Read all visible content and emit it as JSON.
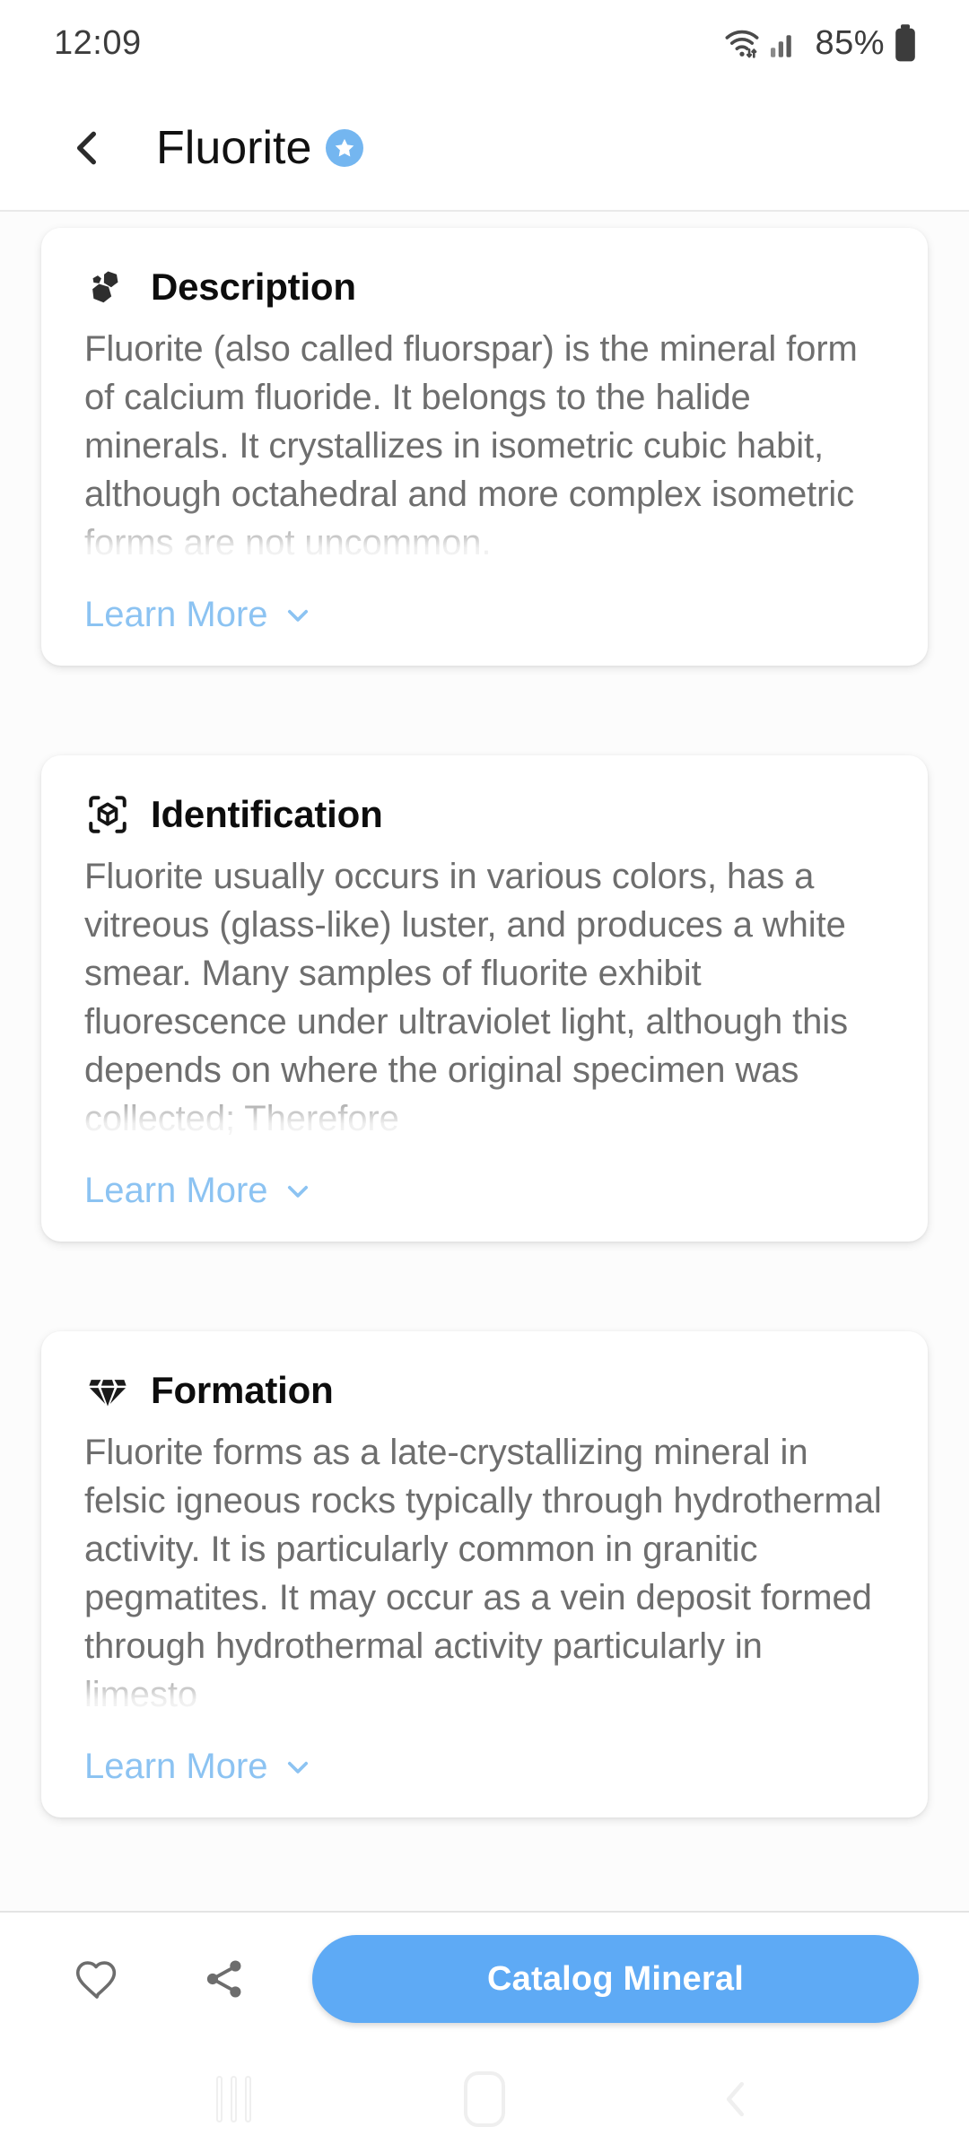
{
  "status_bar": {
    "time": "12:09",
    "battery_percent": "85%",
    "wifi_icon": "wifi-icon",
    "signal_icon": "cellular-signal-icon",
    "battery_icon": "battery-icon"
  },
  "header": {
    "back_icon": "chevron-left-icon",
    "title": "Fluorite",
    "verified_badge_icon": "star-badge-icon",
    "badge_color": "#74b6f0"
  },
  "cards": [
    {
      "icon": "rocks-icon",
      "title": "Description",
      "body": "Fluorite (also called fluorspar) is the mineral form of calcium fluoride. It belongs to the halide minerals. It crystallizes in isometric cubic habit, although octahedral and more complex isometric forms are not uncommon.",
      "learn_more_label": "Learn More",
      "learn_more_icon": "chevron-down-icon",
      "clamp_class": "clamp-5"
    },
    {
      "icon": "cube-scan-icon",
      "title": "Identification",
      "body": "Fluorite usually occurs in various colors, has a vitreous (glass-like) luster, and produces a white smear. Many samples of fluorite exhibit fluorescence under ultraviolet light, although this depends on where the original specimen was collected; Therefore",
      "learn_more_label": "Learn More",
      "learn_more_icon": "chevron-down-icon",
      "clamp_class": "clamp-6"
    },
    {
      "icon": "gem-icon",
      "title": "Formation",
      "body": "Fluorite forms as a late-crystallizing mineral in felsic igneous rocks typically through hydrothermal activity. It is particularly common in granitic pegmatites. It may occur as a vein deposit formed through hydrothermal activity particularly in limesto",
      "learn_more_label": "Learn More",
      "learn_more_icon": "chevron-down-icon",
      "clamp_class": "clamp-6"
    }
  ],
  "action_bar": {
    "favorite_icon": "heart-outline-icon",
    "share_icon": "share-icon",
    "catalog_label": "Catalog Mineral",
    "catalog_color": "#5eaaf5"
  },
  "nav_bar": {
    "recents_icon": "recents-icon",
    "home_icon": "home-icon",
    "back_icon": "back-chevron-icon"
  }
}
